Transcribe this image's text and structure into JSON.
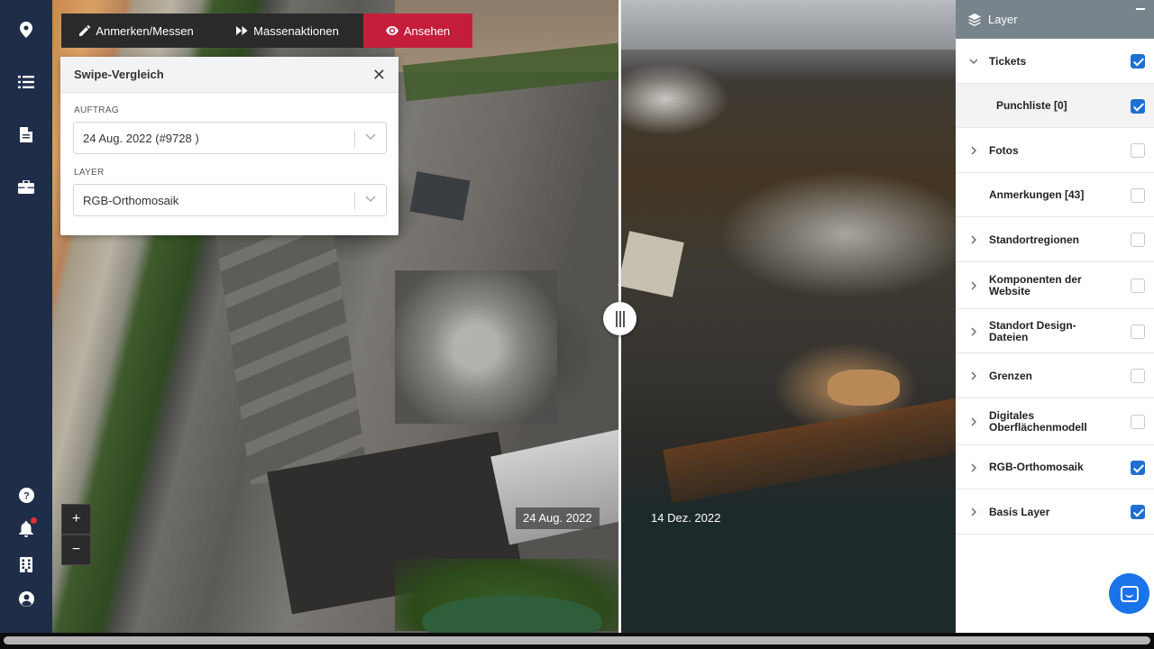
{
  "toolbar": {
    "annotate_label": "Anmerken/Messen",
    "bulk_label": "Massenaktionen",
    "view_label": "Ansehen",
    "active_color": "#c41e3a"
  },
  "swipe_panel": {
    "title": "Swipe-Vergleich",
    "order_label": "AUFTRAG",
    "order_value": "24 Aug. 2022 (#9728 )",
    "layer_label": "LAYER",
    "layer_value": "RGB-Orthomosaik"
  },
  "map": {
    "left_date": "24 Aug. 2022",
    "right_date": "14 Dez. 2022"
  },
  "layers_panel": {
    "title": "Layer",
    "items": [
      {
        "label": "Tickets",
        "caret": "down",
        "checked": true
      },
      {
        "label": "Punchliste [0]",
        "caret": "none",
        "checked": true
      },
      {
        "label": "Fotos",
        "caret": "right",
        "checked": false
      },
      {
        "label": "Anmerkungen [43]",
        "caret": "none",
        "checked": false
      },
      {
        "label": "Standortregionen",
        "caret": "right",
        "checked": false
      },
      {
        "label": "Komponenten der Website",
        "caret": "right",
        "checked": false
      },
      {
        "label": "Standort Design-Dateien",
        "caret": "right",
        "checked": false
      },
      {
        "label": "Grenzen",
        "caret": "right",
        "checked": false
      },
      {
        "label": "Digitales Oberflächenmodell",
        "caret": "right",
        "checked": false
      },
      {
        "label": "RGB-Orthomosaik",
        "caret": "right",
        "checked": true
      },
      {
        "label": "Basis Layer",
        "caret": "right",
        "checked": true
      }
    ]
  },
  "colors": {
    "rail": "#1e2d48",
    "checkbox_on": "#1f6fd1",
    "chat": "#1a73e8"
  },
  "icons": [
    "map-pin-icon",
    "list-icon",
    "document-icon",
    "briefcase-icon",
    "help-icon",
    "bell-icon",
    "building-icon",
    "user-icon",
    "pencil-icon",
    "fast-forward-icon",
    "eye-icon",
    "layers-icon",
    "close-icon",
    "chevron-down-icon",
    "chat-icon"
  ]
}
